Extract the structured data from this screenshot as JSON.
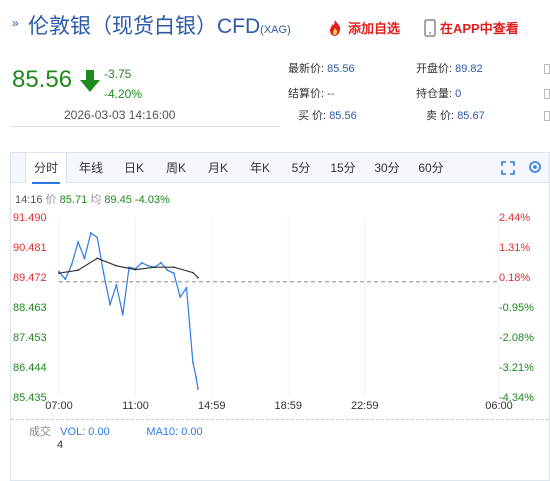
{
  "header": {
    "title": "伦敦银（现货白银）CFD",
    "title_code": "(XAG)",
    "fav_label": "添加自选",
    "app_label": "在APP中查看"
  },
  "quote": {
    "price": "85.56",
    "change": "-3.75",
    "change_pct": "-4.20%",
    "datetime": "2026-03-03 14:16:00",
    "latest_label": "最新价:",
    "latest_value": "85.56",
    "settle_label": "结算价:",
    "settle_value": "--",
    "buy_label": "买 价:",
    "buy_value": "85.56",
    "open_label": "开盘价:",
    "open_value": "89.82",
    "oi_label": "持仓量:",
    "oi_value": "0",
    "sell_label": "卖 价:",
    "sell_value": "85.67"
  },
  "tabs": [
    "分时",
    "年线",
    "日K",
    "周K",
    "月K",
    "年K",
    "5分",
    "15分",
    "30分",
    "60分"
  ],
  "info": {
    "time": "14:16",
    "price_label": "价",
    "price": "85.71",
    "avg_label": "均",
    "avg": "89.45",
    "pct": "-4.03%"
  },
  "volume": {
    "label": "成交",
    "vol_text": "VOL: 0.00",
    "ma_text": "MA10: 0.00",
    "axis_value": "4"
  },
  "chart_data": {
    "type": "line",
    "title": "",
    "left_ticks": [
      "91.490",
      "90.481",
      "89.472",
      "88.463",
      "87.453",
      "86.444",
      "85.435"
    ],
    "right_ticks": [
      "2.44%",
      "1.31%",
      "0.18%",
      "-0.95%",
      "-2.08%",
      "-3.21%",
      "-4.34%"
    ],
    "x_ticks": [
      "07:00",
      "11:00",
      "14:59",
      "18:59",
      "22:59",
      "06:00"
    ],
    "ylim": [
      85.435,
      91.49
    ],
    "prev_close": 89.31,
    "colors": {
      "up": "#e03030",
      "down": "#1e8a1e",
      "price_line": "#2c7be5",
      "avg_line": "#333333"
    },
    "series": [
      {
        "name": "价",
        "x": [
          "07:00",
          "07:20",
          "07:40",
          "08:00",
          "08:20",
          "08:40",
          "09:00",
          "09:20",
          "09:40",
          "10:00",
          "10:20",
          "10:40",
          "11:00",
          "11:20",
          "11:40",
          "12:00",
          "12:20",
          "12:40",
          "13:00",
          "13:20",
          "13:40",
          "14:00",
          "14:10",
          "14:16"
        ],
        "values": [
          89.65,
          89.4,
          89.9,
          90.65,
          90.1,
          90.95,
          90.8,
          89.6,
          88.55,
          89.2,
          88.2,
          89.8,
          89.75,
          89.95,
          89.85,
          89.8,
          89.95,
          89.7,
          89.6,
          88.8,
          89.1,
          86.6,
          86.1,
          85.71
        ]
      },
      {
        "name": "均",
        "x": [
          "07:00",
          "08:00",
          "09:00",
          "10:00",
          "11:00",
          "12:00",
          "13:00",
          "14:00",
          "14:16"
        ],
        "values": [
          89.6,
          89.7,
          90.1,
          89.85,
          89.72,
          89.8,
          89.8,
          89.62,
          89.45
        ]
      }
    ]
  }
}
